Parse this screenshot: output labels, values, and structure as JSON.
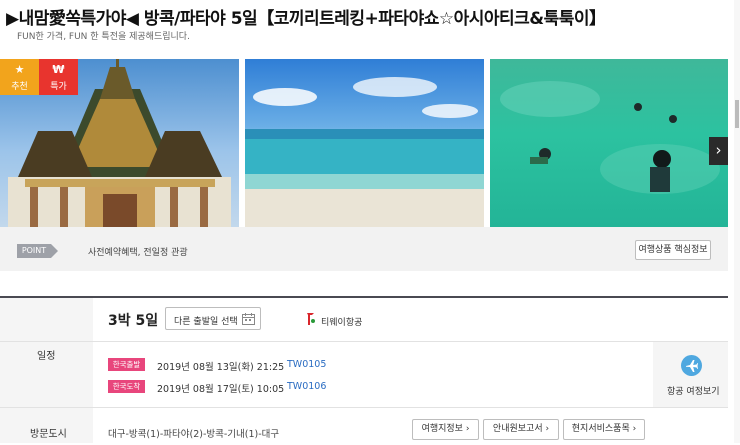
{
  "header": {
    "title": "▶내맘愛쏙특가야◀ 방콕/파타야 5일【코끼리트레킹+파타야쇼☆아시아티크&툭툭이】",
    "subtitle": "FUN한 가격, FUN 한 특전을 제공해드립니다."
  },
  "badges": [
    {
      "icon": "★",
      "label": "추천",
      "color": "#f2a41c"
    },
    {
      "icon": "₩",
      "label": "특가",
      "color": "#e8342e"
    }
  ],
  "gallery": {
    "images": [
      "temple-photo",
      "beach-photo",
      "snorkeling-photo"
    ],
    "next_icon": "›"
  },
  "point": {
    "tag": "POINT",
    "text": "사전예약혜택, 전일정 관광",
    "button": "여행상품 핵심정보"
  },
  "itinerary": {
    "label": "일정",
    "duration": "3박 5일",
    "other_dates_button": "다른 출발일 선택",
    "airline": "티웨이항공",
    "departure": {
      "tag": "한국출발",
      "datetime": "2019년 08월 13일(화) 21:25",
      "flight": "TW0105"
    },
    "arrival": {
      "tag": "한국도착",
      "datetime": "2019년 08월 17일(토) 10:05",
      "flight": "TW0106"
    },
    "flight_schedule_button": "항공 여정보기",
    "tag_color": "#e8467c"
  },
  "cities": {
    "label": "방문도시",
    "route": "대구-방콕(1)-파타야(2)-방콕-기내(1)-대구",
    "buttons": [
      "여행지정보 ›",
      "안내원보고서 ›",
      "현지서비스품목 ›"
    ]
  }
}
